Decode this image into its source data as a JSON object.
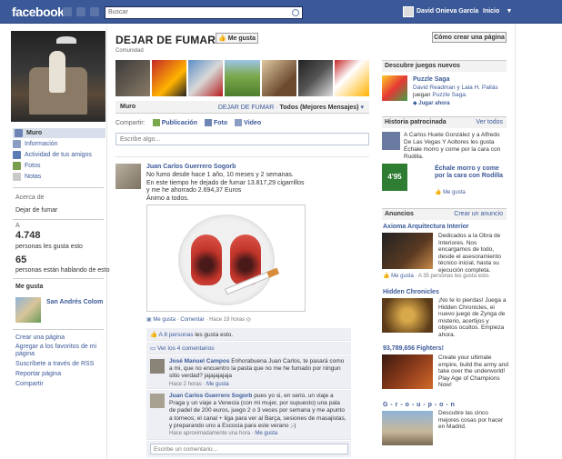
{
  "topbar": {
    "logo": "facebook",
    "search_placeholder": "Buscar",
    "user_name": "David Onieva García",
    "home": "Inicio",
    "menu_glyph": "▼",
    "bar_color": "#3b5998"
  },
  "left": {
    "nav": [
      {
        "label": "Muro",
        "icon": "wall-icon"
      },
      {
        "label": "Información",
        "icon": "info-icon"
      },
      {
        "label": "Actividad de tus amigos",
        "icon": "friends-activity-icon"
      },
      {
        "label": "Fotos",
        "icon": "photos-icon"
      },
      {
        "label": "Notas",
        "icon": "notes-icon"
      }
    ],
    "about_title": "Acerca de",
    "about_text": "Dejar de fumar",
    "likes_count": "4.748",
    "likes_label": "personas les gusta esto",
    "talking_count": "65",
    "talking_label": "personas están hablando de esto",
    "likes_title": "Me gusta",
    "liked_page": "San Andrés Colom",
    "links": [
      "Crear una página",
      "Agregar a los favoritos de mi página",
      "Suscríbete a través de RSS",
      "Reportar página",
      "Compartir"
    ]
  },
  "page": {
    "title": "DEJAR DE FUMAR",
    "category": "Comunidad",
    "like_button": "Me gusta",
    "create_button": "Cómo crear una página"
  },
  "tabs": {
    "muro": "Muro",
    "filter_prefix": "DEJAR DE FUMAR ·",
    "filter_value": "Todos (Mejores Mensajes)"
  },
  "share": {
    "label": "Compartir:",
    "options": [
      "Publicación",
      "Foto",
      "Video"
    ],
    "placeholder": "Escribe algo..."
  },
  "post": {
    "author": "Juan Carlos Guerrero Sogorb",
    "text": "No fumo desde hace 1 año, 10 meses y 2 semanas.\nEn este tiempo he dejado de fumar 13.817,29 cigarrillos\ny me he ahorrado 2.694,37 Euros\nÁnimo a todos.",
    "meta_like": "Me gusta",
    "meta_comment": "Comentar",
    "meta_time": "Hace 19 horas",
    "likes_text": "A 8 personas",
    "likes_suffix": "les gusta esto.",
    "view_comments": "Ver los 4 comentarios",
    "comments": [
      {
        "author": "José Manuel Campos",
        "text": "Enhorabuena Juan Carlos, te pasará como a mi, que no encuentro la pasta que no me he fumado por ningun sitio verdad? jajajajajaja",
        "time": "Hace 2 horas",
        "like": "Me gusta"
      },
      {
        "author": "Juan Carlos Guerrero Sogorb",
        "text": "pues yo si, en serio, un viaje a Praga y un viaje a Venecia (con mi mujer, por supuesto) una pala de padel de 200 euros, juego 2 o 3 veces por semana y me apunto a torneos; el canal + liga para ver al Barça, sesiones de masajistas, y preparando uno a Escocia para este verano ;-)",
        "time": "Hace aproximadamente una hora",
        "like": "Me gusta"
      }
    ],
    "comment_placeholder": "Escribe un comentario..."
  },
  "right": {
    "games_title": "Descubre juegos nuevos",
    "game": {
      "name": "Puzzle Saga",
      "friends": "David Readman y Laia H. Pallás",
      "playing": "juegan",
      "playing_game": "Puzzle Saga.",
      "cta": "Jugar ahora"
    },
    "sponsored_title": "Historia patrocinada",
    "sponsored_link": "Ver todos",
    "sponsored_story": "A Carlos Huete González y a Alfredo De Las Vegas Y Aoltores les gusta Échale morro y come por la cara con Rodilla.",
    "sponsored_ad_title": "Échale morro y come por la cara con Rodilla",
    "sponsored_price": "4'95",
    "sponsored_like": "Me gusta",
    "ads_title": "Anuncios",
    "ads_link": "Crear un anuncio",
    "ads": [
      {
        "title": "Axioma Arquitectura Interior",
        "text": "Dedicados a la Obra de Interiores. Nos encargamos de todo, desde el asesoramiento técnico inicial, hasta su ejecución completa.",
        "like": "Me gusta",
        "like_count": "A 35 personas les gusta esto."
      },
      {
        "title": "Hidden Chronicles",
        "text": "¡No te lo pierdas! Juega a Hidden Chronicles, el nuevo juego de Zynga de misterio, acertijos y objetos ocultos. Empieza ahora."
      },
      {
        "title": "93,789,656 Fighters!",
        "text": "Create your ultimate empire, build the army and take over the underworld! Play Age of Champions Now!"
      },
      {
        "title": "G - r - o - u - p - o - n",
        "text": "Descubre las cinco mejores cosas por hacer en Madrid."
      }
    ]
  }
}
